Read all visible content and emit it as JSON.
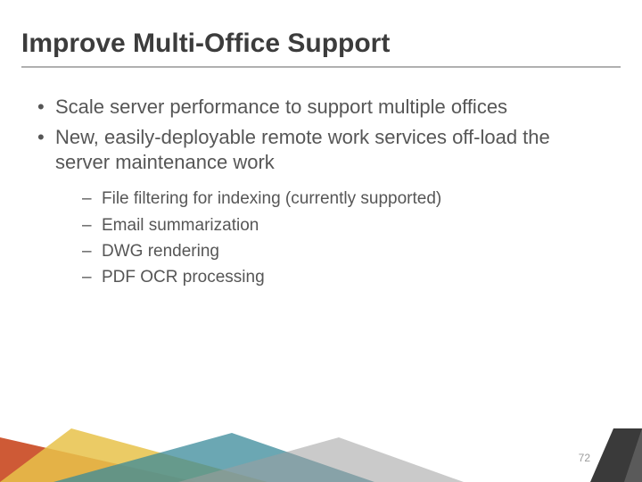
{
  "title": "Improve Multi-Office Support",
  "bullets": [
    {
      "text": "Scale server performance to support multiple offices"
    },
    {
      "text": "New, easily-deployable remote work services off-load the server maintenance work"
    }
  ],
  "sub_bullets": [
    {
      "text": "File filtering for indexing (currently supported)"
    },
    {
      "text": "Email summarization"
    },
    {
      "text": "DWG rendering"
    },
    {
      "text": "PDF OCR processing"
    }
  ],
  "page_number": "72"
}
